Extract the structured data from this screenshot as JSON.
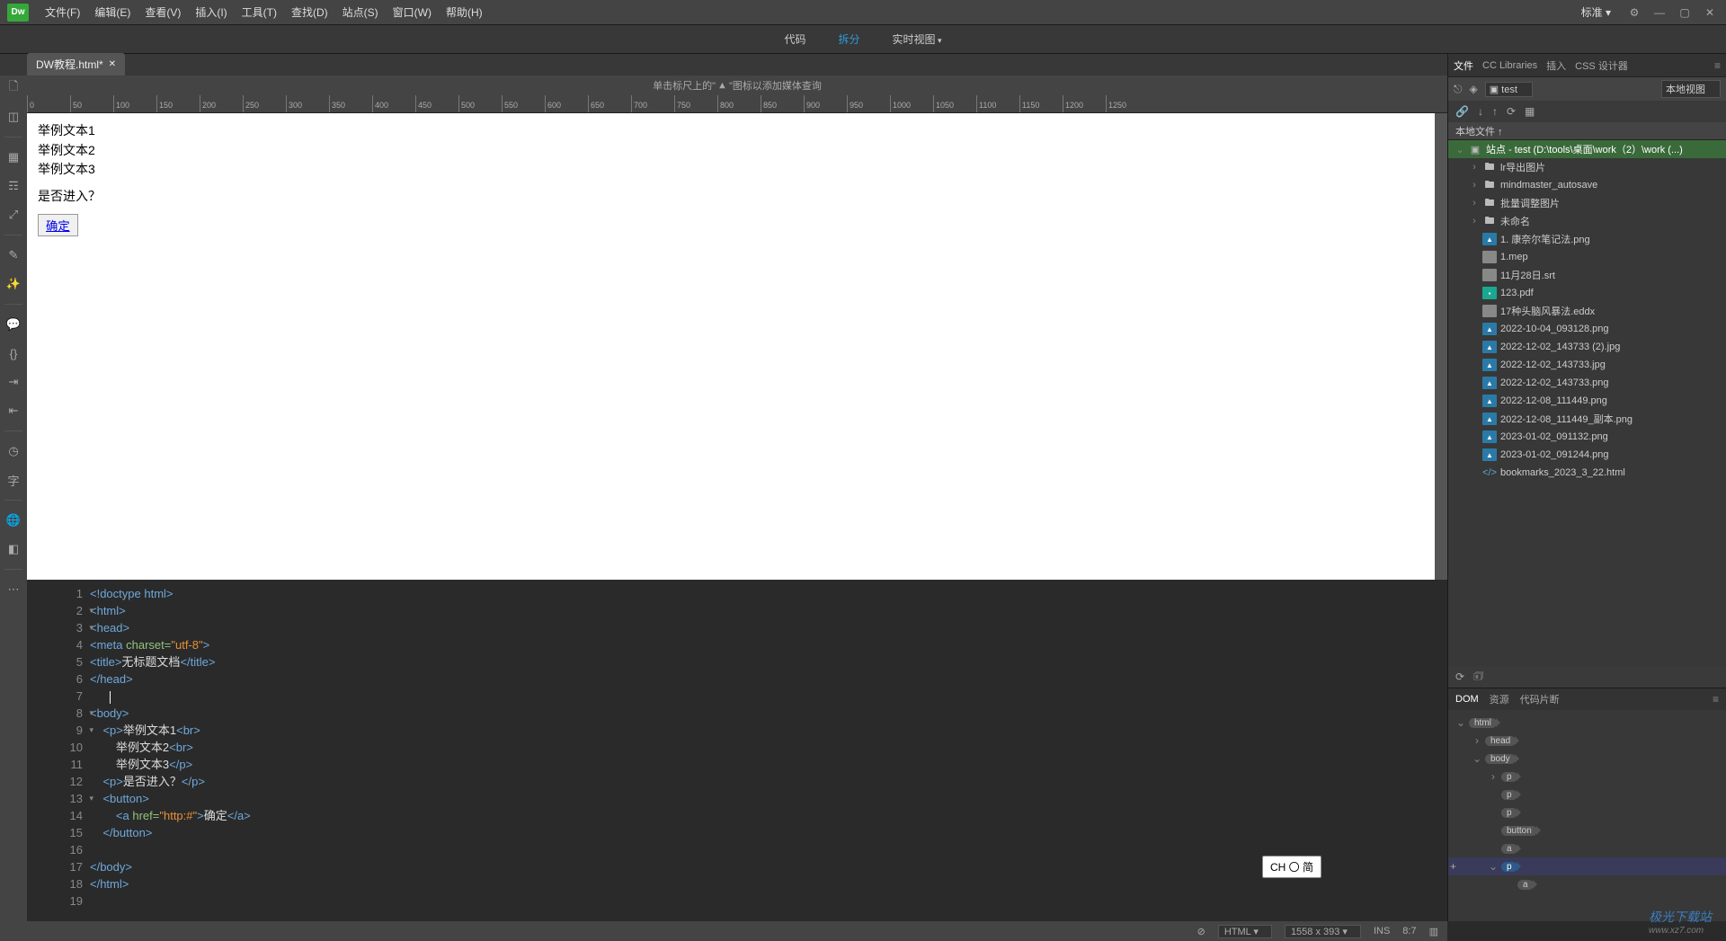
{
  "menubar": {
    "items": [
      "文件(F)",
      "编辑(E)",
      "查看(V)",
      "插入(I)",
      "工具(T)",
      "查找(D)",
      "站点(S)",
      "窗口(W)",
      "帮助(H)"
    ],
    "workspace": "标准 ▾"
  },
  "viewbar": {
    "code": "代码",
    "split": "拆分",
    "live": "实时视图"
  },
  "tab": {
    "name": "DW教程.html*"
  },
  "mq_hint": {
    "pre": "单击标尺上的\"",
    "post": "\"图标以添加媒体查询"
  },
  "ruler_ticks": [
    0,
    50,
    100,
    150,
    200,
    250,
    300,
    350,
    400,
    450,
    500,
    550,
    600,
    650,
    700,
    750,
    800,
    850,
    900,
    950,
    1000,
    1050,
    1100,
    1150,
    1200,
    1250
  ],
  "preview": {
    "line1": "举例文本1",
    "line2": "举例文本2",
    "line3": "举例文本3",
    "prompt": "是否进入？",
    "ok": "确定"
  },
  "code": {
    "lines": [
      {
        "n": 1,
        "fold": false,
        "html": "<span class='tag'>&lt;!doctype html&gt;</span>"
      },
      {
        "n": 2,
        "fold": true,
        "html": "<span class='tag'>&lt;html&gt;</span>"
      },
      {
        "n": 3,
        "fold": true,
        "html": "<span class='tag'>&lt;head&gt;</span>"
      },
      {
        "n": 4,
        "fold": false,
        "html": "<span class='tag'>&lt;meta</span> <span class='attr'>charset=</span><span class='str'>\"utf-8\"</span><span class='tag'>&gt;</span>"
      },
      {
        "n": 5,
        "fold": false,
        "html": "<span class='tag'>&lt;title&gt;</span><span class='txt'>无标题文档</span><span class='tag'>&lt;/title&gt;</span>"
      },
      {
        "n": 6,
        "fold": false,
        "html": "<span class='tag'>&lt;/head&gt;</span>"
      },
      {
        "n": 7,
        "fold": false,
        "html": "      <span class='cursor'></span>"
      },
      {
        "n": 8,
        "fold": true,
        "html": "<span class='tag'>&lt;body&gt;</span>"
      },
      {
        "n": 9,
        "fold": true,
        "html": "    <span class='tag'>&lt;p&gt;</span><span class='txt'>举例文本1</span><span class='tag'>&lt;br&gt;</span>"
      },
      {
        "n": 10,
        "fold": false,
        "html": "        <span class='txt'>举例文本2</span><span class='tag'>&lt;br&gt;</span>"
      },
      {
        "n": 11,
        "fold": false,
        "html": "        <span class='txt'>举例文本3</span><span class='tag'>&lt;/p&gt;</span>"
      },
      {
        "n": 12,
        "fold": false,
        "html": "    <span class='tag'>&lt;p&gt;</span><span class='txt'>是否进入？</span><span class='tag'>&lt;/p&gt;</span>"
      },
      {
        "n": 13,
        "fold": true,
        "html": "    <span class='tag'>&lt;button&gt;</span>"
      },
      {
        "n": 14,
        "fold": false,
        "html": "        <span class='tag'>&lt;a</span> <span class='attr'>href=</span><span class='str'>\"http:#\"</span><span class='tag'>&gt;</span><span class='txt'>确定</span><span class='tag'>&lt;/a&gt;</span>"
      },
      {
        "n": 15,
        "fold": false,
        "html": "    <span class='tag'>&lt;/button&gt;</span>"
      },
      {
        "n": 16,
        "fold": false,
        "html": ""
      },
      {
        "n": 17,
        "fold": false,
        "html": "<span class='tag'>&lt;/body&gt;</span>"
      },
      {
        "n": 18,
        "fold": false,
        "html": "<span class='tag'>&lt;/html&gt;</span>"
      },
      {
        "n": 19,
        "fold": false,
        "html": ""
      }
    ]
  },
  "ime": "CH 〇 简",
  "right": {
    "tabs": [
      "文件",
      "CC Libraries",
      "插入",
      "CSS 设计器"
    ],
    "site_select": "▣ test",
    "view_select": "本地视图",
    "header": "本地文件 ↑",
    "root": "站点 - test (D:\\tools\\桌面\\work（2）\\work (...)",
    "folders": [
      "lr导出图片",
      "mindmaster_autosave",
      "批量调整图片",
      "未命名"
    ],
    "files": [
      {
        "name": "1. 康奈尔笔记法.png",
        "type": "img"
      },
      {
        "name": "1.mep",
        "type": "generic"
      },
      {
        "name": "11月28日.srt",
        "type": "generic"
      },
      {
        "name": "123.pdf",
        "type": "pdf"
      },
      {
        "name": "17种头脑风暴法.eddx",
        "type": "generic"
      },
      {
        "name": "2022-10-04_093128.png",
        "type": "img"
      },
      {
        "name": "2022-12-02_143733 (2).jpg",
        "type": "img"
      },
      {
        "name": "2022-12-02_143733.jpg",
        "type": "img"
      },
      {
        "name": "2022-12-02_143733.png",
        "type": "img"
      },
      {
        "name": "2022-12-08_111449.png",
        "type": "img"
      },
      {
        "name": "2022-12-08_111449_副本.png",
        "type": "img"
      },
      {
        "name": "2023-01-02_091132.png",
        "type": "img"
      },
      {
        "name": "2023-01-02_091244.png",
        "type": "img"
      },
      {
        "name": "bookmarks_2023_3_22.html",
        "type": "html"
      }
    ]
  },
  "dom": {
    "tabs": [
      "DOM",
      "资源",
      "代码片断"
    ],
    "nodes": [
      {
        "indent": 0,
        "tag": "html",
        "tw": "⌄",
        "sel": false
      },
      {
        "indent": 1,
        "tag": "head",
        "tw": "›",
        "sel": false
      },
      {
        "indent": 1,
        "tag": "body",
        "tw": "⌄",
        "sel": false
      },
      {
        "indent": 2,
        "tag": "p",
        "tw": "›",
        "sel": false
      },
      {
        "indent": 2,
        "tag": "p",
        "tw": "",
        "sel": false
      },
      {
        "indent": 2,
        "tag": "p",
        "tw": "",
        "sel": false
      },
      {
        "indent": 2,
        "tag": "button",
        "tw": "",
        "sel": false
      },
      {
        "indent": 2,
        "tag": "a",
        "tw": "",
        "sel": false
      },
      {
        "indent": 2,
        "tag": "p",
        "tw": "⌄",
        "sel": true,
        "add": true
      },
      {
        "indent": 3,
        "tag": "a",
        "tw": "",
        "sel": false
      }
    ]
  },
  "statusbar": {
    "lang": "HTML",
    "size": "1558 x 393",
    "ins": "INS",
    "pos": "8:7"
  },
  "watermark": {
    "main": "极光下载站",
    "sub": "www.xz7.com"
  }
}
